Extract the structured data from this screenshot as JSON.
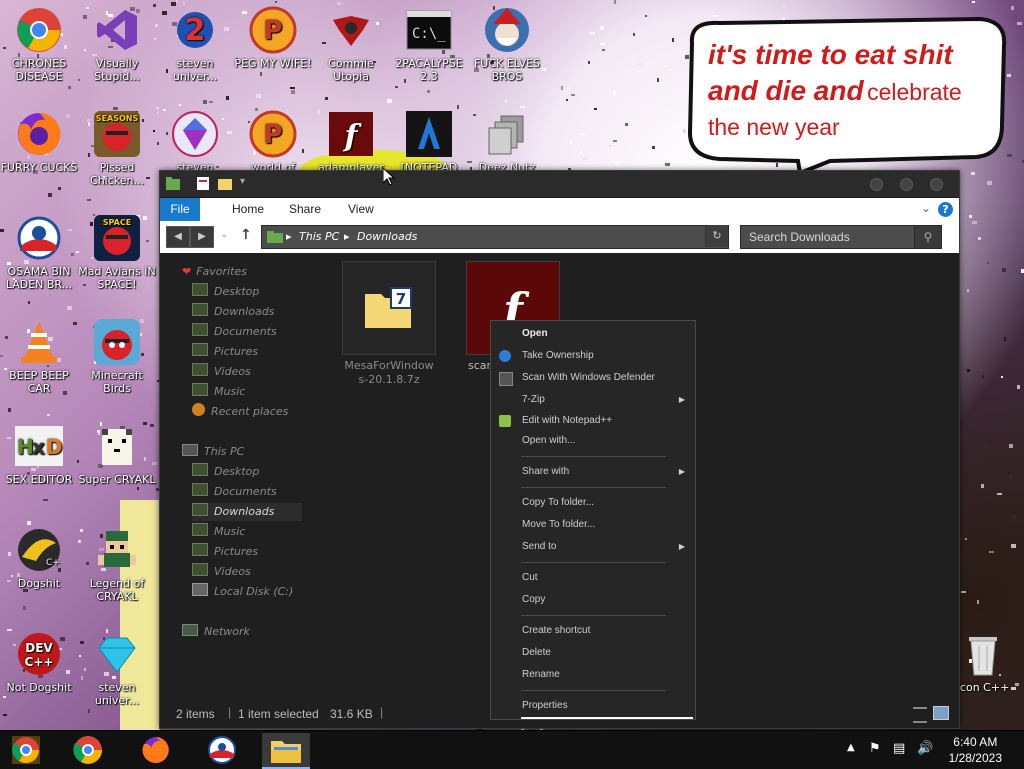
{
  "desktop": {
    "icons": [
      {
        "label": "CHRONES DISEASE",
        "icon": "chrome-icon"
      },
      {
        "label": "Visually Stupid...",
        "icon": "visual-studio-icon"
      },
      {
        "label": "steven univer...",
        "icon": "game-2-icon"
      },
      {
        "label": "PEG MY WIFE!",
        "icon": "peggle-icon"
      },
      {
        "label": "Commie Utopia",
        "icon": "soviet-icon"
      },
      {
        "label": "2PACALYPSE 2.3",
        "icon": "terminal-icon"
      },
      {
        "label": "FUCK ELVES BROS",
        "icon": "wizard-icon"
      },
      {
        "label": "FURRY CUCKS",
        "icon": "firefox-icon"
      },
      {
        "label": "Pissed Chicken...",
        "icon": "angry-birds-seasons-icon"
      },
      {
        "label": "steven",
        "icon": "gem-icon"
      },
      {
        "label": "world of",
        "icon": "peggle-icon"
      },
      {
        "label": "adamplayer",
        "icon": "flash-icon"
      },
      {
        "label": "[NOTEPAD",
        "icon": "notepad-icon"
      },
      {
        "label": "Deez Nutz",
        "icon": "copy-icon"
      },
      {
        "label": "OSAMA BIN LADEN BR...",
        "icon": "obama-logo-icon"
      },
      {
        "label": "Mad Avians IN SPACE!",
        "icon": "angry-birds-space-icon"
      },
      {
        "label": "BEEP BEEP CAR",
        "icon": "vlc-icon"
      },
      {
        "label": "Minecraft Birds",
        "icon": "angry-birds-icon"
      },
      {
        "label": "SEX EDITOR",
        "icon": "hxd-icon"
      },
      {
        "label": "Super CRYAKL",
        "icon": "pixel-cat-icon"
      },
      {
        "label": "Dogshit",
        "icon": "dogshit-icon"
      },
      {
        "label": "Legend of CRYAKL",
        "icon": "pixel-hero-icon"
      },
      {
        "label": "Not Dogshit",
        "icon": "dev-cpp-icon"
      },
      {
        "label": "steven univer...",
        "icon": "diamond-icon"
      },
      {
        "label": "Icon C++",
        "icon": "recycle-bin-icon"
      }
    ],
    "speech_bubble": {
      "line1": "it's time to eat shit",
      "line2a": "and die and",
      "line2b": "celebrate",
      "line3": "the new year"
    }
  },
  "explorer": {
    "ribbon": {
      "tabs": [
        "File",
        "Home",
        "Share",
        "View"
      ],
      "help": "?"
    },
    "address": {
      "segments": [
        "This PC",
        "Downloads"
      ]
    },
    "search": {
      "placeholder": "Search Downloads"
    },
    "nav": {
      "favorites_label": "Favorites",
      "favorites": [
        "Desktop",
        "Downloads",
        "Documents",
        "Pictures",
        "Videos",
        "Music",
        "Recent places"
      ],
      "thispc_label": "This PC",
      "thispc": [
        "Desktop",
        "Documents",
        "Downloads",
        "Music",
        "Pictures",
        "Videos",
        "Local Disk (C:)"
      ],
      "network_label": "Network"
    },
    "files": [
      {
        "name": "MesaForWindows-20.1.8.7z",
        "line1": "MesaForWindow",
        "line2": "s-20.1.8.7z"
      },
      {
        "name": "scan",
        "line1": "scan",
        "line2": ""
      }
    ],
    "status": {
      "items": "2 items",
      "selected": "1 item selected",
      "size": "31.6 KB"
    }
  },
  "context_menu": {
    "open": "Open",
    "take_ownership": "Take Ownership",
    "scan_defender": "Scan With Windows Defender",
    "seven_zip": "7-Zip",
    "edit_notepadpp": "Edit with Notepad++",
    "open_with": "Open with...",
    "share_with": "Share with",
    "copy_to": "Copy To folder...",
    "move_to": "Move To folder...",
    "send_to": "Send to",
    "cut": "Cut",
    "copy": "Copy",
    "create_shortcut": "Create shortcut",
    "delete": "Delete",
    "rename": "Rename",
    "properties": "Properties"
  },
  "taskbar": {
    "apps": [
      "chrome-canary-icon",
      "chrome-icon",
      "firefox-icon",
      "obama-logo-icon",
      "file-explorer-icon"
    ],
    "time": "6:40 AM",
    "date": "1/28/2023"
  },
  "colors": {
    "accent": "#1979ca",
    "explorer_bg": "#1f1f1f",
    "bubble_text": "#d21a1a"
  }
}
